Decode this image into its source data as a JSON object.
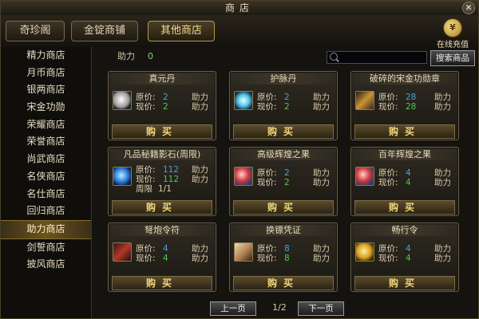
{
  "window": {
    "title": "商店",
    "close_glyph": "✕"
  },
  "tabs": [
    {
      "label": "奇珍阁"
    },
    {
      "label": "金锭商铺"
    },
    {
      "label": "其他商店"
    }
  ],
  "recharge": {
    "label": "在线充值"
  },
  "sidebar": {
    "items": [
      {
        "label": "精力商店"
      },
      {
        "label": "月币商店"
      },
      {
        "label": "银两商店"
      },
      {
        "label": "宋金功勋"
      },
      {
        "label": "荣耀商店"
      },
      {
        "label": "荣誉商店"
      },
      {
        "label": "尚武商店"
      },
      {
        "label": "名侠商店"
      },
      {
        "label": "名仕商店"
      },
      {
        "label": "回归商店"
      },
      {
        "label": "助力商店"
      },
      {
        "label": "剑誓商店"
      },
      {
        "label": "披风商店"
      }
    ],
    "active_index": 10
  },
  "power": {
    "label": "助力",
    "value": "0"
  },
  "search": {
    "placeholder": "",
    "button_label": "搜索商品"
  },
  "labels": {
    "original_price": "原价:",
    "current_price": "现价:",
    "limit": "周限",
    "unit": "助力",
    "buy": "购买"
  },
  "items": [
    {
      "title": "真元丹",
      "original": "2",
      "current": "2",
      "unit": "助力",
      "icon": "white-gem-icon"
    },
    {
      "title": "护脉丹",
      "original": "2",
      "current": "2",
      "unit": "助力",
      "icon": "glowing-orb-icon"
    },
    {
      "title": "破碎的宋金功勋章",
      "original": "28",
      "current": "28",
      "unit": "助力",
      "icon": "broken-medal-icon"
    },
    {
      "title": "凡品秘籍影石(周限)",
      "original": "112",
      "current": "112",
      "unit": "助力",
      "limit": "1/1",
      "icon": "blue-stone-icon"
    },
    {
      "title": "高级辉煌之果",
      "original": "2",
      "current": "2",
      "unit": "助力",
      "icon": "red-fruit-icon"
    },
    {
      "title": "百年辉煌之果",
      "original": "4",
      "current": "4",
      "unit": "助力",
      "icon": "red-fruit-icon"
    },
    {
      "title": "弩炮令符",
      "original": "4",
      "current": "4",
      "unit": "助力",
      "icon": "token-icon"
    },
    {
      "title": "换镖凭证",
      "original": "8",
      "current": "8",
      "unit": "助力",
      "icon": "scroll-icon"
    },
    {
      "title": "畅行令",
      "original": "4",
      "current": "4",
      "unit": "助力",
      "icon": "gold-badge-icon"
    }
  ],
  "pager": {
    "prev": "上一页",
    "next": "下一页",
    "page": "1/2"
  },
  "colors": {
    "accent_gold": "#f0d67a",
    "price_blue": "#4aa0d8",
    "price_green": "#57c44a"
  }
}
